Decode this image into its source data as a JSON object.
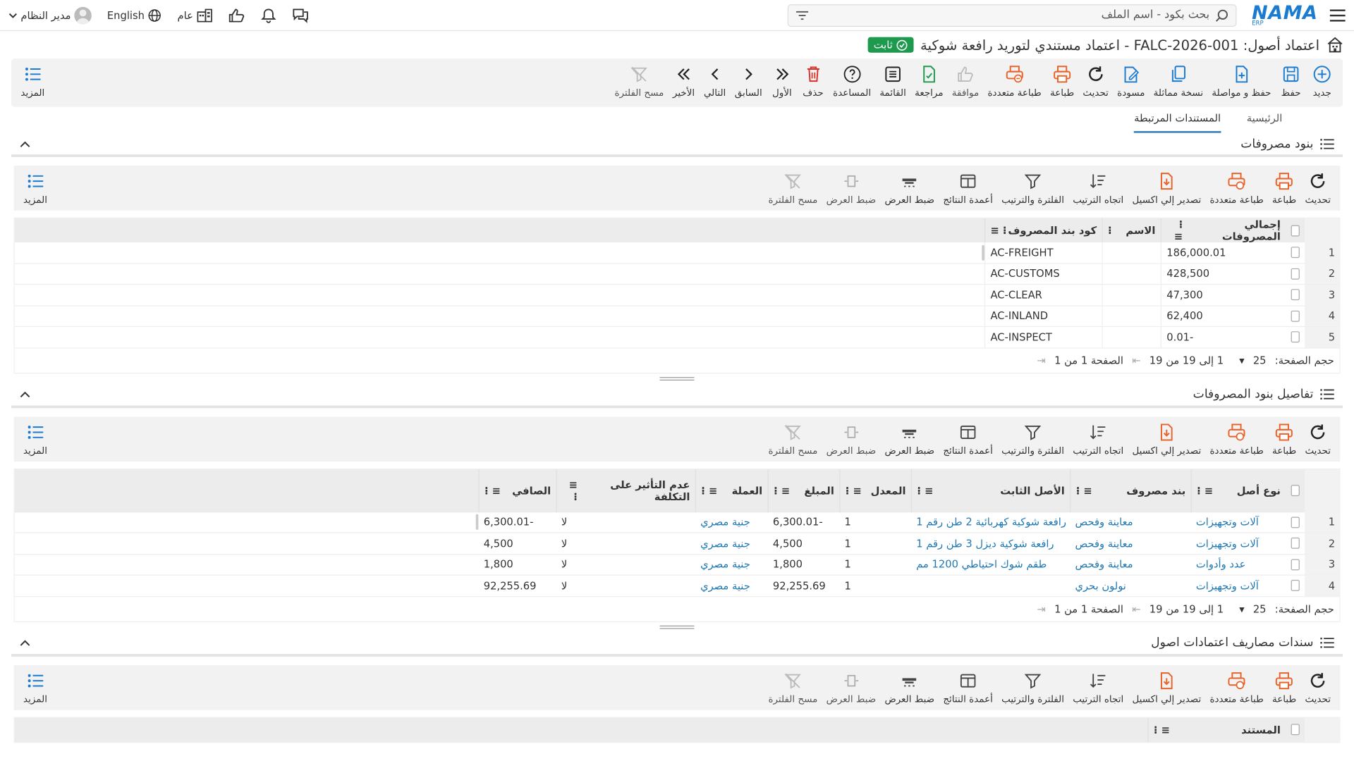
{
  "topbar": {
    "search_placeholder": "بحث بكود - اسم الملف",
    "logo": "NAMA",
    "logo_sub": "ERP",
    "user": "مدير النظام",
    "language": "English",
    "scope": "عام"
  },
  "page": {
    "title": "اعتماد أصول: FALC-2026-001 - اعتماد مستندي لتوريد رافعة شوكية",
    "status": "ثابت"
  },
  "main_toolbar": {
    "buttons": [
      "جديد",
      "حفظ",
      "حفظ و مواصلة",
      "نسخة مماثلة",
      "مسودة",
      "تحديث",
      "طباعة",
      "طباعة متعددة",
      "موافقة",
      "مراجعة",
      "القائمة",
      "المساعدة",
      "حذف",
      "الأول",
      "السابق",
      "التالي",
      "الأخير",
      "مسح الفلترة"
    ],
    "more": "المزيد"
  },
  "tabs": [
    "الرئيسية",
    "المستندات المرتبطة"
  ],
  "grid_toolbar": {
    "buttons": [
      "تحديث",
      "طباعة",
      "طباعة متعددة",
      "تصدير إلي اكسيل",
      "اتجاه الترتيب",
      "الفلترة والترتيب",
      "أعمدة النتائج",
      "ضبط العرض",
      "ضبط العرض",
      "مسح الفلترة"
    ],
    "more": "المزيد"
  },
  "pager": {
    "page_size_label": "حجم الصفحة:",
    "page_size": "25",
    "range": "1 إلى 19 من 19",
    "page_label": "الصفحة 1 من 1"
  },
  "section1": {
    "title": "بنود مصروفات",
    "headers": [
      "إجمالي المصروفات",
      "الاسم",
      "كود بند المصروف"
    ],
    "rows": [
      {
        "n": "1",
        "total": "186,000.01",
        "name": "",
        "code": "AC-FREIGHT"
      },
      {
        "n": "2",
        "total": "428,500",
        "name": "",
        "code": "AC-CUSTOMS"
      },
      {
        "n": "3",
        "total": "47,300",
        "name": "",
        "code": "AC-CLEAR"
      },
      {
        "n": "4",
        "total": "62,400",
        "name": "",
        "code": "AC-INLAND"
      },
      {
        "n": "5",
        "total": "-0.01",
        "name": "",
        "code": "AC-INSPECT"
      }
    ]
  },
  "section2": {
    "title": "تفاصيل بنود المصروفات",
    "headers": [
      "نوع أصل",
      "بند مصروف",
      "الأصل الثابت",
      "المعدل",
      "المبلغ",
      "العملة",
      "عدم التأثير على التكلفة",
      "الصافي"
    ],
    "rows": [
      {
        "n": "1",
        "type": "آلات وتجهيزات",
        "item": "معاينة وفحص",
        "asset": "رافعة شوكية كهربائية 2 طن رقم 1",
        "rate": "1",
        "amount": "-6,300.01",
        "currency": "جنية مصري",
        "no_effect": "لا",
        "net": "-6,300.01"
      },
      {
        "n": "2",
        "type": "آلات وتجهيزات",
        "item": "معاينة وفحص",
        "asset": "رافعة شوكية ديزل 3 طن رقم 1",
        "rate": "1",
        "amount": "4,500",
        "currency": "جنية مصري",
        "no_effect": "لا",
        "net": "4,500"
      },
      {
        "n": "3",
        "type": "عدد وأدوات",
        "item": "معاينة وفحص",
        "asset": "طقم شوك احتياطي 1200 مم",
        "rate": "1",
        "amount": "1,800",
        "currency": "جنية مصري",
        "no_effect": "لا",
        "net": "1,800"
      },
      {
        "n": "4",
        "type": "آلات وتجهيزات",
        "item": "نولون بحري",
        "asset": "",
        "rate": "1",
        "amount": "92,255.69",
        "currency": "جنية مصري",
        "no_effect": "لا",
        "net": "92,255.69"
      }
    ]
  },
  "section3": {
    "title": "سندات مصاريف اعتمادات اصول",
    "headers": [
      "المستند"
    ]
  },
  "colors": {
    "accent": "#1a7bd0",
    "link": "#1f78b4",
    "status_green": "#1d9a4d",
    "orange": "#e8632a"
  }
}
